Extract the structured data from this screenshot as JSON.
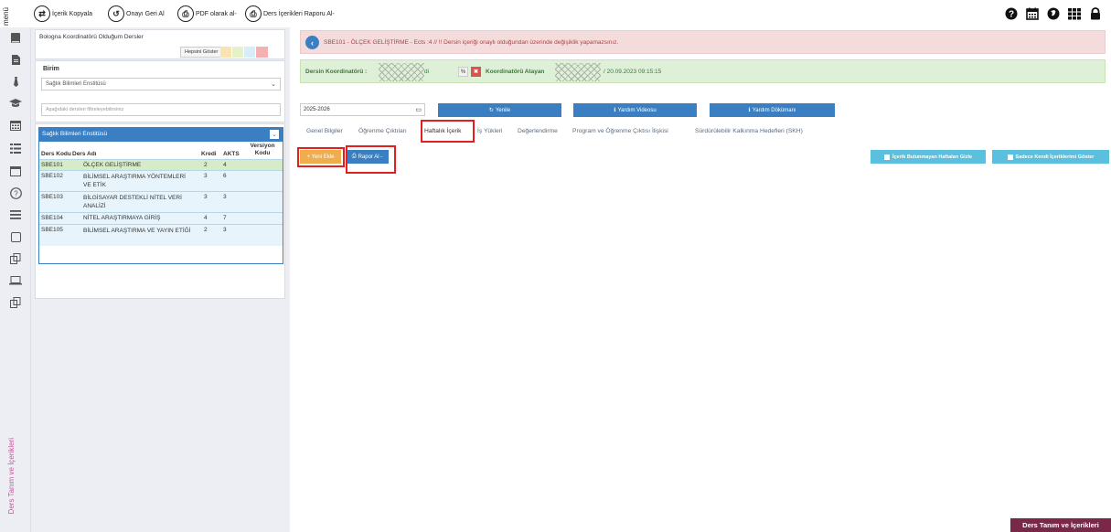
{
  "toolbar": {
    "menu_label": "menü",
    "buttons": [
      {
        "label": "İçerik Kopyala",
        "icon": "⇄"
      },
      {
        "label": "Onayı Geri Al",
        "icon": "↺"
      },
      {
        "label": "PDF olarak al-",
        "icon": "⎙"
      },
      {
        "label": "Ders İçerikleri Raporu Al-",
        "icon": "⎙"
      }
    ],
    "icons": [
      "help-icon",
      "calendar-icon",
      "globe-icon",
      "grid-icon",
      "lock-icon"
    ]
  },
  "rail": {
    "icons": [
      "book-icon",
      "document-icon",
      "tie-icon",
      "graduation-cap-icon",
      "calendar-icon",
      "list-icon",
      "calendar-icon",
      "help-circle-icon",
      "menu-icon",
      "square-icon",
      "copy-icon",
      "laptop-icon",
      "copy-icon"
    ],
    "vertical_label": "Ders Tanım ve İçerikleri"
  },
  "left": {
    "title": "Bologna Koordinatörü Olduğum Dersler",
    "show_all": "Hepsini Göster",
    "swatches": [
      "#f8e3b3",
      "#e4f2c9",
      "#d6eef8",
      "#f4b1b1"
    ],
    "birim_label": "Birim",
    "birim_value": "Sağlık Bilimleri Enstitüsü",
    "filter_placeholder": "Aşağıdaki dersleri filtreleyebilirsiniz",
    "panel_title": "Sağlık Bilimleri Enstitüsü",
    "columns": {
      "code": "Ders Kodu",
      "name": "Ders Adı",
      "kredi": "Kredi",
      "akts": "AKTS",
      "version": "Versiyon Kodu"
    },
    "courses": [
      {
        "code": "SBE101",
        "name": "ÖLÇEK GELİŞTİRME",
        "kredi": "2",
        "akts": "4",
        "selected": true
      },
      {
        "code": "SBE102",
        "name": "BİLİMSEL ARAŞTIRMA YÖNTEMLERİ VE ETİK",
        "kredi": "3",
        "akts": "6",
        "selected": false
      },
      {
        "code": "SBE103",
        "name": "BİLGİSAYAR DESTEKLİ NİTEL VERİ ANALİZİ",
        "kredi": "3",
        "akts": "3",
        "selected": false
      },
      {
        "code": "SBE104",
        "name": "NİTEL ARAŞTIRMAYA GİRİŞ",
        "kredi": "4",
        "akts": "7",
        "selected": false
      },
      {
        "code": "SBE105",
        "name": "BİLİMSEL ARAŞTIRMA VE YAYIN ETİĞİ",
        "kredi": "2",
        "akts": "3",
        "selected": false
      }
    ]
  },
  "main": {
    "alert": "SBE101 - ÖLÇEK GELİŞTİRME - Ects :4 // !! Dersin içeriği onaylı olduğundan üzerinde değişiklik yapamazsınız.",
    "coord_label": "Dersin Koordinatörü :",
    "coord_suffix": "di",
    "assigner_label": "Koordinatörü Atayan",
    "assign_date": "/ 20.09.2023 09:15:15",
    "year": "2025-2026",
    "refresh": "Yenile",
    "help_video": "Yardım Videosu",
    "help_doc": "Yardım Dökümanı",
    "tabs": [
      "Genel Bilgiler",
      "Öğrenme Çıktıları",
      "Haftalık İçerik",
      "İş Yükleri",
      "Değerlendirme",
      "Program ve Öğrenme Çıktısı İlişkisi",
      "Sürdürülebilir Kalkınma Hedefleri (SKH)"
    ],
    "add_new": "+ Yeni Ekle",
    "report": "Rapor Al -",
    "hide_empty": "İçerik Bulunmayan Haftaları Gizle",
    "own_only": "Sadece Kendi İçeriklerimi Göster",
    "bottom_tag": "Ders Tanım ve İçerikleri"
  }
}
